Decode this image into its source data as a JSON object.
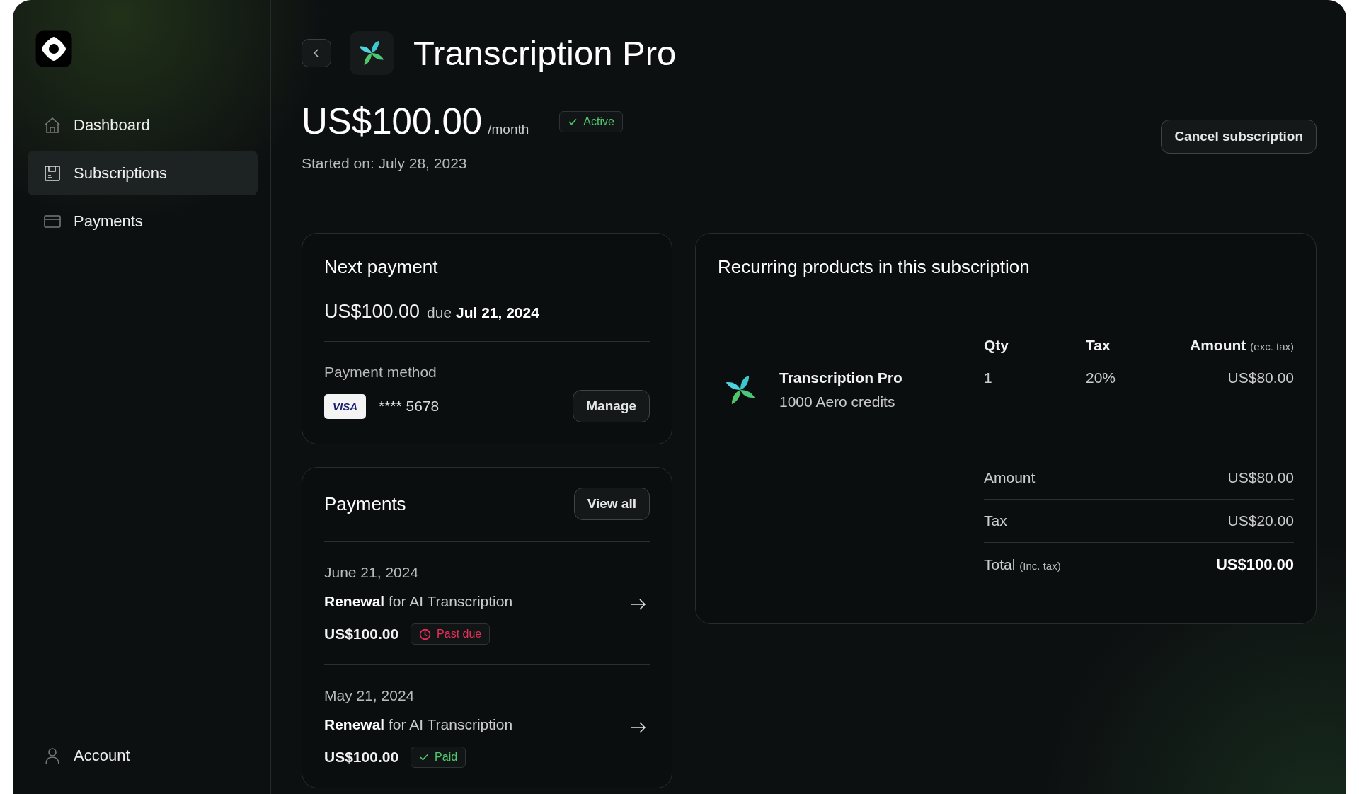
{
  "sidebar": {
    "nav": [
      {
        "label": "Dashboard",
        "selected": false
      },
      {
        "label": "Subscriptions",
        "selected": true
      },
      {
        "label": "Payments",
        "selected": false
      }
    ],
    "account": {
      "label": "Account"
    }
  },
  "header": {
    "title": "Transcription Pro",
    "price": "US$100.00",
    "period": "/month",
    "status": {
      "label": "Active",
      "kind": "success"
    },
    "started": "Started on: July 28, 2023",
    "cancel_button": "Cancel subscription"
  },
  "next_payment": {
    "title": "Next payment",
    "amount": "US$100.00",
    "due": "due **Jul 21, 2024**",
    "method_label": "Payment method",
    "card_brand": "VISA",
    "card_number": "**** 5678",
    "manage_button": "Manage"
  },
  "payments": {
    "title": "Payments",
    "view_all_button": "View all",
    "items": [
      {
        "date": "June 21, 2024",
        "description": "**Renewal** for AI Transcription",
        "amount": "US$100.00",
        "status": {
          "label": "Past due",
          "kind": "danger"
        }
      },
      {
        "date": "May 21, 2024",
        "description": "**Renewal** for AI Transcription",
        "amount": "US$100.00",
        "status": {
          "label": "Paid",
          "kind": "success"
        }
      }
    ]
  },
  "products": {
    "title": "Recurring products in this subscription",
    "columns": [
      {
        "label": "Qty"
      },
      {
        "label": "Tax"
      },
      {
        "label": "Amount",
        "note": "(exc. tax)"
      }
    ],
    "rows": [
      {
        "name": "Transcription Pro",
        "subtitle": "1000 Aero credits",
        "qty": "1",
        "tax": "20%",
        "amount": "US$80.00"
      }
    ],
    "summary": [
      {
        "label": "Amount",
        "value": "US$80.00",
        "kind": "line"
      },
      {
        "label": "Tax",
        "value": "US$20.00",
        "kind": "line"
      },
      {
        "label": "Total",
        "note": "(Inc. tax)",
        "value": "US$100.00",
        "kind": "total"
      }
    ]
  }
}
